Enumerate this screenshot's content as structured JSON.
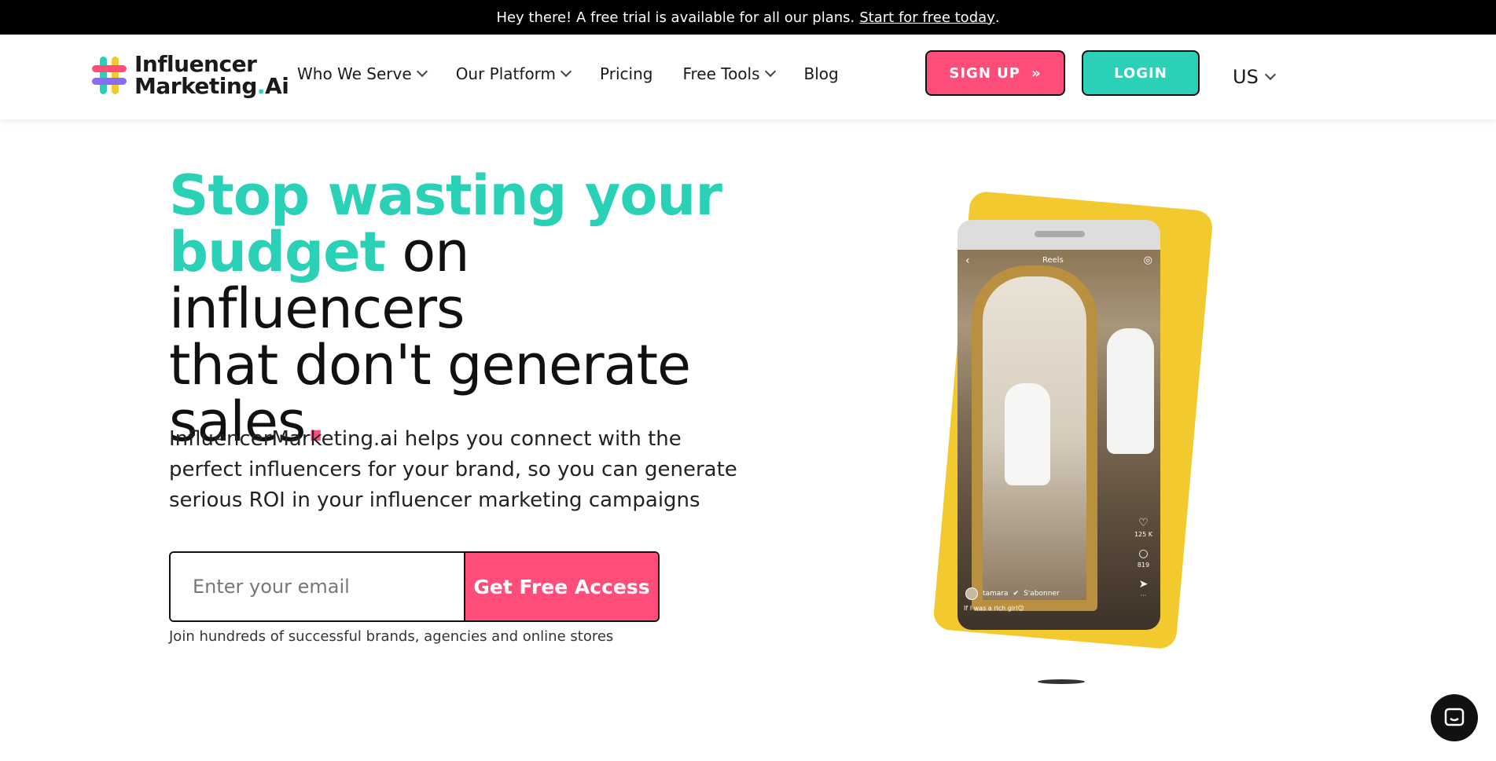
{
  "topbar": {
    "message": "Hey there! A free trial is available for all our plans.",
    "link_text": "Start for free today",
    "period": "."
  },
  "header": {
    "logo_line1": "Influencer",
    "logo_line2": "Marketing",
    "logo_dot": ".",
    "logo_ai": "Ai",
    "nav": [
      {
        "label": "Who We Serve",
        "has_dropdown": true
      },
      {
        "label": "Our Platform",
        "has_dropdown": true
      },
      {
        "label": "Pricing",
        "has_dropdown": false
      },
      {
        "label": "Free Tools",
        "has_dropdown": true
      },
      {
        "label": "Blog",
        "has_dropdown": false
      }
    ],
    "signup_label": "SIGN UP",
    "signup_icon": "»",
    "login_label": "LOGIN",
    "locale": "US"
  },
  "hero": {
    "title_accent": "Stop wasting your budget",
    "title_rest_1": " on influencers",
    "title_rest_2": "that don't generate",
    "title_rest_3": "sales",
    "title_dot": ".",
    "subtitle": "InfluencerMarketing.ai helps you connect with the perfect influencers for your brand, so you can generate serious ROI in your influencer marketing campaigns",
    "email_placeholder": "Enter your email",
    "cta_label": "Get Free Access",
    "join_text": "Join hundreds of successful brands, agencies and online stores"
  },
  "phone": {
    "reels_label": "Reels",
    "back_icon": "‹",
    "camera_icon": "◎",
    "likes": "125 K",
    "comments": "819",
    "username": "tamara",
    "verified": "✔",
    "subscribe": "S'abonner",
    "caption": "If I was a rich girl😉"
  },
  "colors": {
    "accent_teal": "#2bd1b6",
    "accent_pink": "#ff4d7a",
    "card_yellow": "#f2c92e"
  }
}
